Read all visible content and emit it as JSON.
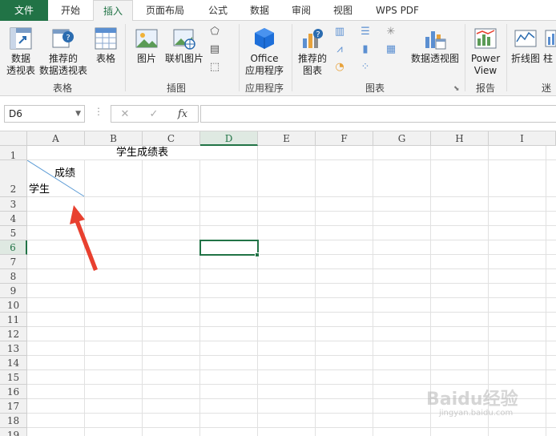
{
  "tabs": [
    {
      "label": "文件"
    },
    {
      "label": "开始"
    },
    {
      "label": "插入"
    },
    {
      "label": "页面布局"
    },
    {
      "label": "公式"
    },
    {
      "label": "数据"
    },
    {
      "label": "审阅"
    },
    {
      "label": "视图"
    },
    {
      "label": "WPS PDF"
    }
  ],
  "ribbon": {
    "pivot_table": "数据\n透视表",
    "pivot_table_l1": "数据",
    "pivot_table_l2": "透视表",
    "recommended_pivot_l1": "推荐的",
    "recommended_pivot_l2": "数据透视表",
    "table": "表格",
    "group_tables": "表格",
    "picture": "图片",
    "online_picture": "联机图片",
    "group_illustrations": "插图",
    "office_l1": "Office",
    "office_l2": "应用程序",
    "group_apps": "应用程序",
    "recommended_chart_l1": "推荐的",
    "recommended_chart_l2": "图表",
    "group_charts": "图表",
    "pivot_chart": "数据透视图",
    "power_view_l1": "Power",
    "power_view_l2": "View",
    "group_reports": "报告",
    "sparkline_line": "折线图",
    "sparkline_col": "柱",
    "group_sparklines": "迷"
  },
  "formula_bar": {
    "name_box": "D6",
    "cancel_glyph": "✕",
    "enter_glyph": "✓",
    "fx_glyph": "fx",
    "value": ""
  },
  "grid": {
    "columns": [
      "A",
      "B",
      "C",
      "D",
      "E",
      "F",
      "G",
      "H",
      "I"
    ],
    "rows": [
      "1",
      "2",
      "3",
      "4",
      "5",
      "6",
      "7",
      "8",
      "9",
      "10",
      "11",
      "12",
      "13",
      "14",
      "15",
      "16",
      "17",
      "18",
      "19"
    ],
    "selected_column": "D",
    "selected_row": "6",
    "active_cell": "D6",
    "cells": {
      "B1_title": "学生成绩表",
      "A2_top_right": "成绩",
      "A2_bottom_left": "学生"
    }
  },
  "colors": {
    "accent": "#217346",
    "annotation_arrow": "#e8402f",
    "diagonal": "#5b9bd5"
  },
  "watermark": {
    "brand": "Baidu经验",
    "url": "jingyan.baidu.com"
  }
}
